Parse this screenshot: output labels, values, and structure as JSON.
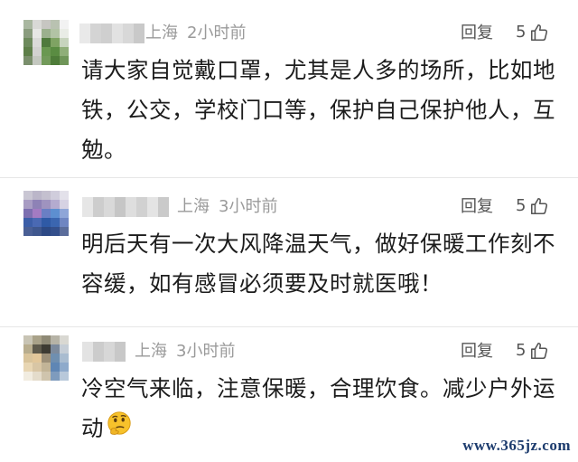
{
  "comments": [
    {
      "location": "上海",
      "time": "2小时前",
      "reply_label": "回复",
      "like_count": "5",
      "text": "请大家自觉戴口罩，尤其是人多的场所，比如地铁，公交，学校门口等，保护自己保护他人，互勉。"
    },
    {
      "location": "上海",
      "time": "3小时前",
      "reply_label": "回复",
      "like_count": "5",
      "text": "明后天有一次大风降温天气，做好保暖工作刻不容缓，如有感冒必须要及时就医哦！"
    },
    {
      "location": "上海",
      "time": "3小时前",
      "reply_label": "回复",
      "like_count": "5",
      "text": "冷空气来临，注意保暖，合理饮食。减少户外运动"
    }
  ],
  "icons": {
    "like": "thumbs-up-icon",
    "emoji": "thinking-face-emoji"
  },
  "colors": {
    "meta": "#9a9a9a",
    "text": "#1c1c1c",
    "watermark": "#1d3c6e"
  },
  "watermark": "www.365jz.com"
}
